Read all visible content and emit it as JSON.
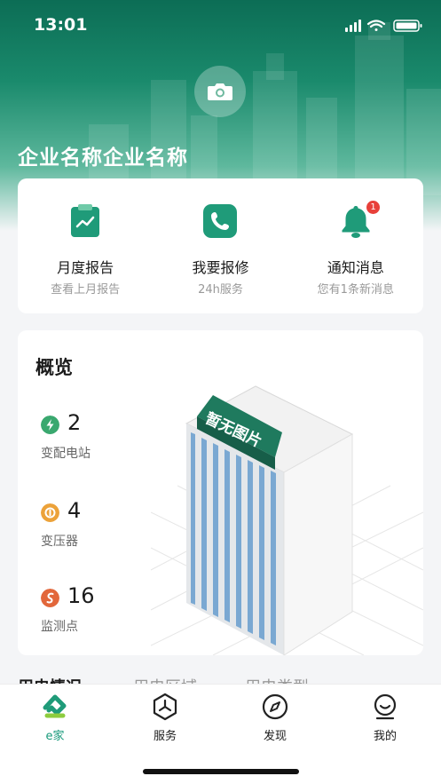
{
  "status": {
    "time": "13:01"
  },
  "header": {
    "company_name": "企业名称企业名称"
  },
  "actions": [
    {
      "title": "月度报告",
      "subtitle": "查看上月报告",
      "icon": "report-icon"
    },
    {
      "title": "我要报修",
      "subtitle": "24h服务",
      "icon": "phone-icon"
    },
    {
      "title": "通知消息",
      "subtitle": "您有1条新消息",
      "icon": "bell-icon",
      "badge": "1"
    }
  ],
  "overview": {
    "title": "概览",
    "stats": [
      {
        "value": "2",
        "label": "变配电站",
        "icon": "lightning-icon",
        "color": "#3aa86f"
      },
      {
        "value": "4",
        "label": "变压器",
        "icon": "transformer-icon",
        "color": "#eca23a"
      },
      {
        "value": "16",
        "label": "监测点",
        "icon": "monitor-icon",
        "color": "#e2673b"
      }
    ],
    "placeholder_text": "暂无图片"
  },
  "sections": {
    "tabs": [
      "用电情况",
      "用电区域",
      "用电类型"
    ]
  },
  "tabbar": [
    {
      "label": "e家",
      "icon": "e-home-icon",
      "active": true
    },
    {
      "label": "服务",
      "icon": "service-icon"
    },
    {
      "label": "发现",
      "icon": "compass-icon"
    },
    {
      "label": "我的",
      "icon": "profile-icon"
    }
  ],
  "colors": {
    "brand": "#16997a",
    "hero": "#0c6d55",
    "badge": "#e8403a"
  }
}
